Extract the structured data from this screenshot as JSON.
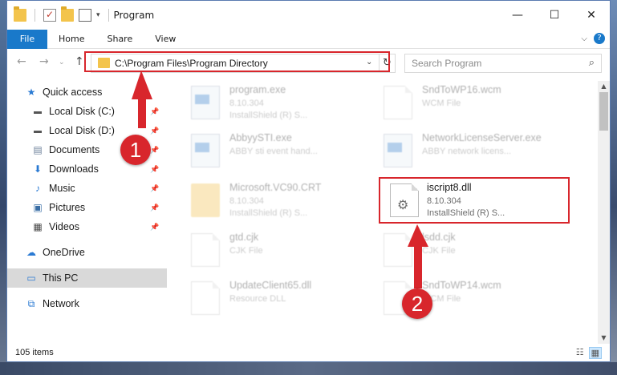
{
  "window": {
    "title": "Program",
    "controls": {
      "minimize": "—",
      "maximize": "☐",
      "close": "✕"
    }
  },
  "ribbon": {
    "tabs": [
      "File",
      "Home",
      "Share",
      "View"
    ]
  },
  "address": {
    "path": "C:\\Program Files\\Program Directory",
    "search_placeholder": "Search Program"
  },
  "nav": {
    "items": [
      {
        "label": "Quick access",
        "icon": "star-icon"
      },
      {
        "label": "Local Disk (C:)",
        "icon": "drive-icon",
        "pinned": true
      },
      {
        "label": "Local Disk (D:)",
        "icon": "drive-icon",
        "pinned": true
      },
      {
        "label": "Documents",
        "icon": "documents-icon",
        "pinned": true
      },
      {
        "label": "Downloads",
        "icon": "download-icon",
        "pinned": true
      },
      {
        "label": "Music",
        "icon": "music-icon",
        "pinned": true
      },
      {
        "label": "Pictures",
        "icon": "pictures-icon",
        "pinned": true
      },
      {
        "label": "Videos",
        "icon": "videos-icon",
        "pinned": true
      },
      {
        "label": "OneDrive",
        "icon": "cloud-icon"
      },
      {
        "label": "This PC",
        "icon": "computer-icon"
      },
      {
        "label": "Network",
        "icon": "network-icon"
      }
    ]
  },
  "files": [
    {
      "name": "program.exe",
      "line2": "8.10.304",
      "line3": "InstallShield (R) S..."
    },
    {
      "name": "SndToWP16.wcm",
      "line2": "WCM File",
      "line3": ""
    },
    {
      "name": "AbbyySTI.exe",
      "line2": "ABBY sti event hand...",
      "line3": ""
    },
    {
      "name": "NetworkLicenseServer.exe",
      "line2": "ABBY network licens...",
      "line3": ""
    },
    {
      "name": "Microsoft.VC90.CRT",
      "line2": "8.10.304",
      "line3": "InstallShield (R) S..."
    },
    {
      "name": "iscript8.dll",
      "line2": "8.10.304",
      "line3": "InstallShield (R) S..."
    },
    {
      "name": "gtd.cjk",
      "line2": "CJK File",
      "line3": ""
    },
    {
      "name": "lsdd.cjk",
      "line2": "CJK File",
      "line3": ""
    },
    {
      "name": "UpdateClient65.dll",
      "line2": "Resource DLL",
      "line3": ""
    },
    {
      "name": "SndToWP14.wcm",
      "line2": "WCM File",
      "line3": ""
    }
  ],
  "status": {
    "count": "105 items"
  },
  "annotations": {
    "badge1": "1",
    "badge2": "2",
    "color": "#d8262c"
  }
}
